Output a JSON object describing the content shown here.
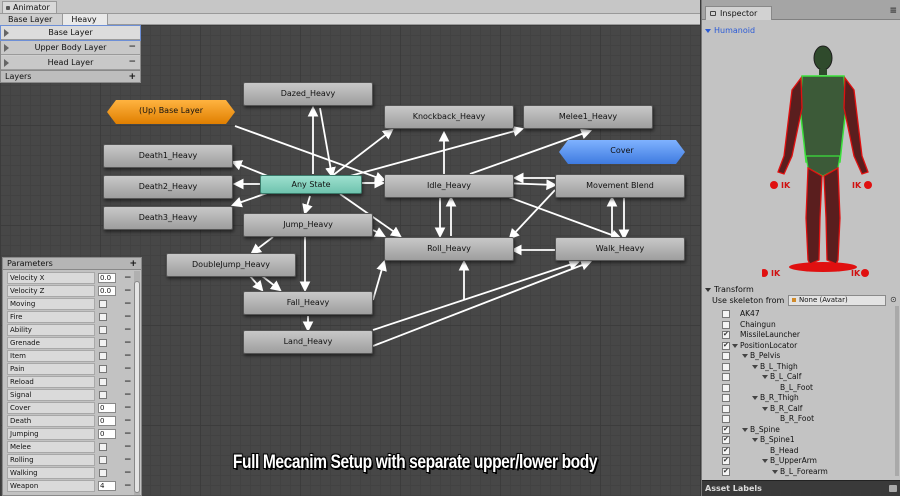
{
  "animator": {
    "window_title": "Animator",
    "breadcrumb": [
      "Base Layer",
      "Heavy"
    ]
  },
  "layers": {
    "items": [
      {
        "name": "Base Layer",
        "selected": true
      },
      {
        "name": "Upper Body Layer",
        "selected": false
      },
      {
        "name": "Head Layer",
        "selected": false
      }
    ],
    "footer_label": "Layers",
    "add_symbol": "+",
    "remove_symbol": "−"
  },
  "states": {
    "up_base_layer": "(Up) Base Layer",
    "dazed": "Dazed_Heavy",
    "knockback": "Knockback_Heavy",
    "melee1": "Melee1_Heavy",
    "death1": "Death1_Heavy",
    "death2": "Death2_Heavy",
    "death3": "Death3_Heavy",
    "any_state": "Any State",
    "idle": "Idle_Heavy",
    "cover": "Cover",
    "movement_blend": "Movement Blend",
    "jump": "Jump_Heavy",
    "roll": "Roll_Heavy",
    "walk": "Walk_Heavy",
    "double_jump": "DoubleJump_Heavy",
    "fall": "Fall_Heavy",
    "land": "Land_Heavy"
  },
  "parameters": {
    "title": "Parameters",
    "add_symbol": "+",
    "remove_symbol": "−",
    "items": [
      {
        "name": "Velocity X",
        "type": "float",
        "value": "0.0"
      },
      {
        "name": "Velocity Z",
        "type": "float",
        "value": "0.0"
      },
      {
        "name": "Moving",
        "type": "bool"
      },
      {
        "name": "Fire",
        "type": "bool"
      },
      {
        "name": "Ability",
        "type": "bool"
      },
      {
        "name": "Grenade",
        "type": "bool"
      },
      {
        "name": "Item",
        "type": "bool"
      },
      {
        "name": "Pain",
        "type": "bool"
      },
      {
        "name": "Reload",
        "type": "bool"
      },
      {
        "name": "Signal",
        "type": "bool"
      },
      {
        "name": "Cover",
        "type": "int",
        "value": "0"
      },
      {
        "name": "Death",
        "type": "int",
        "value": "0"
      },
      {
        "name": "Jumping",
        "type": "int",
        "value": "0"
      },
      {
        "name": "Melee",
        "type": "bool"
      },
      {
        "name": "Rolling",
        "type": "bool"
      },
      {
        "name": "Walking",
        "type": "bool"
      },
      {
        "name": "Weapon",
        "type": "int",
        "value": "4"
      }
    ]
  },
  "caption": "Full Mecanim Setup with separate upper/lower body",
  "inspector": {
    "tab_label": "Inspector",
    "menu_symbol": "≡",
    "humanoid_label": "Humanoid",
    "ik_labels": [
      "IK",
      "IK",
      "IK",
      "IK"
    ],
    "transform_label": "Transform",
    "skeleton_label": "Use skeleton from",
    "skeleton_value": "None (Avatar)",
    "pick_symbol": "⊙",
    "bones": [
      {
        "name": "AK47",
        "depth": 0,
        "checked": false,
        "expanded": false
      },
      {
        "name": "Chaingun",
        "depth": 0,
        "checked": false,
        "expanded": false
      },
      {
        "name": "MissileLauncher",
        "depth": 0,
        "checked": true,
        "expanded": false
      },
      {
        "name": "PositionLocator",
        "depth": 0,
        "checked": true,
        "expanded": true
      },
      {
        "name": "B_Pelvis",
        "depth": 1,
        "checked": false,
        "expanded": true
      },
      {
        "name": "B_L_Thigh",
        "depth": 2,
        "checked": false,
        "expanded": true
      },
      {
        "name": "B_L_Calf",
        "depth": 3,
        "checked": false,
        "expanded": true
      },
      {
        "name": "B_L_Foot",
        "depth": 4,
        "checked": false,
        "expanded": false
      },
      {
        "name": "B_R_Thigh",
        "depth": 2,
        "checked": false,
        "expanded": true
      },
      {
        "name": "B_R_Calf",
        "depth": 3,
        "checked": false,
        "expanded": true
      },
      {
        "name": "B_R_Foot",
        "depth": 4,
        "checked": false,
        "expanded": false
      },
      {
        "name": "B_Spine",
        "depth": 1,
        "checked": true,
        "expanded": true
      },
      {
        "name": "B_Spine1",
        "depth": 2,
        "checked": true,
        "expanded": true
      },
      {
        "name": "B_Head",
        "depth": 3,
        "checked": true,
        "expanded": false
      },
      {
        "name": "B_UpperArm",
        "depth": 3,
        "checked": true,
        "expanded": true
      },
      {
        "name": "B_L_Forearm",
        "depth": 4,
        "checked": true,
        "expanded": true
      }
    ],
    "asset_labels": "Asset Labels"
  },
  "colors": {
    "any_state": "#7fd1bd",
    "sub_state_machine": "#f39a1e",
    "blend_tree_cover": "#5b95f0",
    "avatar_body": "#3c5a38",
    "avatar_outline": "#3be13b",
    "ik_marker": "#e01010",
    "accent_blue": "#2a5ad6"
  }
}
